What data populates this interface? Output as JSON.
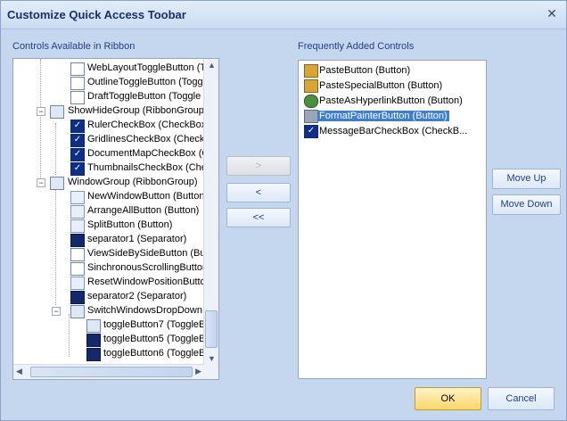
{
  "dialog": {
    "title": "Customize Quick Access Toobar",
    "close_icon": "✕"
  },
  "left_panel": {
    "label": "Controls Available in Ribbon",
    "rows": [
      {
        "label": "WebLayoutToggleButton (T",
        "icon": "web-layout-icon"
      },
      {
        "label": "OutlineToggleButton (Togg",
        "icon": "outline-icon"
      },
      {
        "label": "DraftToggleButton (Toggle",
        "icon": "draft-icon"
      },
      {
        "label": "ShowHideGroup (RibbonGroup",
        "icon": "group-icon",
        "expander": "−"
      },
      {
        "label": "RulerCheckBox (CheckBox",
        "icon": "checkbox-icon"
      },
      {
        "label": "GridlinesCheckBox (CheckB",
        "icon": "checkbox-icon"
      },
      {
        "label": "DocumentMapCheckBox (C",
        "icon": "checkbox-icon"
      },
      {
        "label": "ThumbnailsCheckBox (Che",
        "icon": "checkbox-icon"
      },
      {
        "label": "WindowGroup (RibbonGroup)",
        "icon": "group-icon",
        "expander": "−"
      },
      {
        "label": "NewWindowButton (Button",
        "icon": "new-window-icon"
      },
      {
        "label": "ArrangeAllButton (Button)",
        "icon": "arrange-all-icon"
      },
      {
        "label": "SplitButton (Button)",
        "icon": "split-icon"
      },
      {
        "label": "separator1 (Separator)",
        "icon": "separator-icon"
      },
      {
        "label": "ViewSideBySideButton (But",
        "icon": "side-by-side-icon"
      },
      {
        "label": "SinchronousScrollingButton",
        "icon": "sync-scroll-icon"
      },
      {
        "label": "ResetWindowPositionButto",
        "icon": "reset-window-icon"
      },
      {
        "label": "separator2 (Separator)",
        "icon": "separator-icon"
      },
      {
        "label": "SwitchWindowsDropDown",
        "icon": "dropdown-icon",
        "expander": "−"
      },
      {
        "label": "toggleButton7 (ToggleB",
        "icon": "toggle-icon"
      },
      {
        "label": "toggleButton5 (ToggleB",
        "icon": "toggle-icon"
      },
      {
        "label": "toggleButton6 (ToggleB",
        "icon": "toggle-icon"
      }
    ]
  },
  "transfer_buttons": {
    "add": ">",
    "remove": "<",
    "remove_all": "<<"
  },
  "right_panel": {
    "label": "Frequently Added Controls",
    "items": [
      {
        "label": "PasteButton (Button)",
        "icon": "paste-icon",
        "selected": false
      },
      {
        "label": "PasteSpecialButton (Button)",
        "icon": "paste-special-icon",
        "selected": false
      },
      {
        "label": "PasteAsHyperlinkButton (Button)",
        "icon": "paste-hyperlink-icon",
        "selected": false
      },
      {
        "label": "FormatPainterButton (Button)",
        "icon": "format-painter-icon",
        "selected": true
      },
      {
        "label": "MessageBarCheckBox (CheckB...",
        "icon": "checkbox-icon",
        "selected": false
      }
    ]
  },
  "order_buttons": {
    "move_up": "Move Up",
    "move_down": "Move Down"
  },
  "footer": {
    "ok": "OK",
    "cancel": "Cancel"
  },
  "colors": {
    "dialog_bg": "#c4d7ef",
    "accent": "#1f3f86",
    "selection": "#3f7dd1",
    "ok_button": "#ffd769"
  }
}
